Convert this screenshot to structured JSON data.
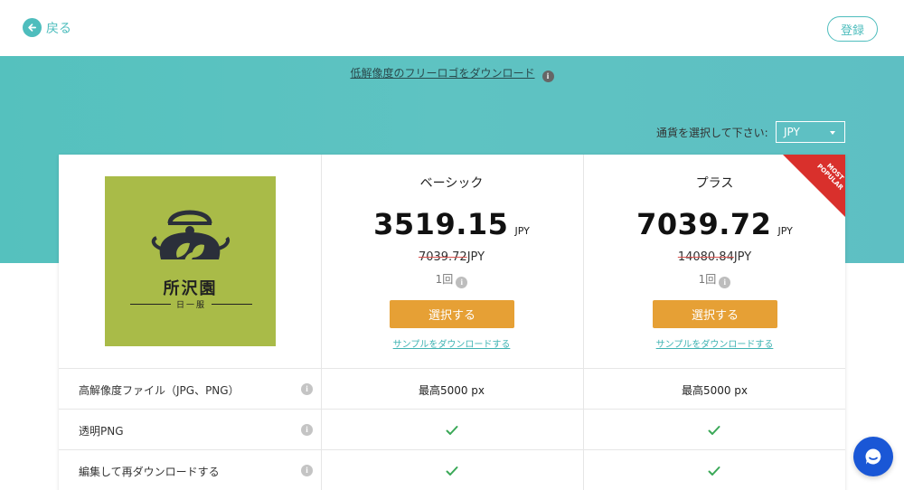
{
  "header": {
    "back_label": "戻る",
    "login_label": "登録"
  },
  "banner": {
    "free_logo_link": "低解像度のフリーロゴをダウンロード"
  },
  "currency": {
    "label": "通貨を選択して下さい:",
    "selected": "JPY"
  },
  "logo": {
    "title": "所沢園",
    "subtitle": "日一服"
  },
  "plans": [
    {
      "name": "ベーシック",
      "price": "3519.15",
      "currency": "JPY",
      "old_price": "7039.72",
      "old_currency": "JPY",
      "times": "1回",
      "select_label": "選択する",
      "sample_link": "サンプルをダウンロードする"
    },
    {
      "name": "プラス",
      "price": "7039.72",
      "currency": "JPY",
      "old_price": "14080.84",
      "old_currency": "JPY",
      "times": "1回",
      "select_label": "選択する",
      "sample_link": "サンプルをダウンロードする",
      "badge": "MOST POPULAR"
    }
  ],
  "features": [
    {
      "label": "高解像度ファイル（JPG、PNG）",
      "basic": "最高5000 px",
      "plus": "最高5000 px"
    },
    {
      "label": "透明PNG",
      "basic": "check",
      "plus": "check"
    },
    {
      "label": "編集して再ダウンロードする",
      "basic": "check",
      "plus": "check"
    }
  ],
  "colors": {
    "teal": "#4ebdbd",
    "band": "#5ec3c2",
    "orange": "#e6a035",
    "red_ribbon": "#d9302c",
    "check_green": "#3aa857",
    "logo_bg": "#a9bb48",
    "chat_blue": "#1a57d6"
  },
  "icons": {
    "back": "arrow-left-circle-icon",
    "info": "info-icon",
    "check": "check-icon",
    "chat": "chat-bubble-icon"
  }
}
